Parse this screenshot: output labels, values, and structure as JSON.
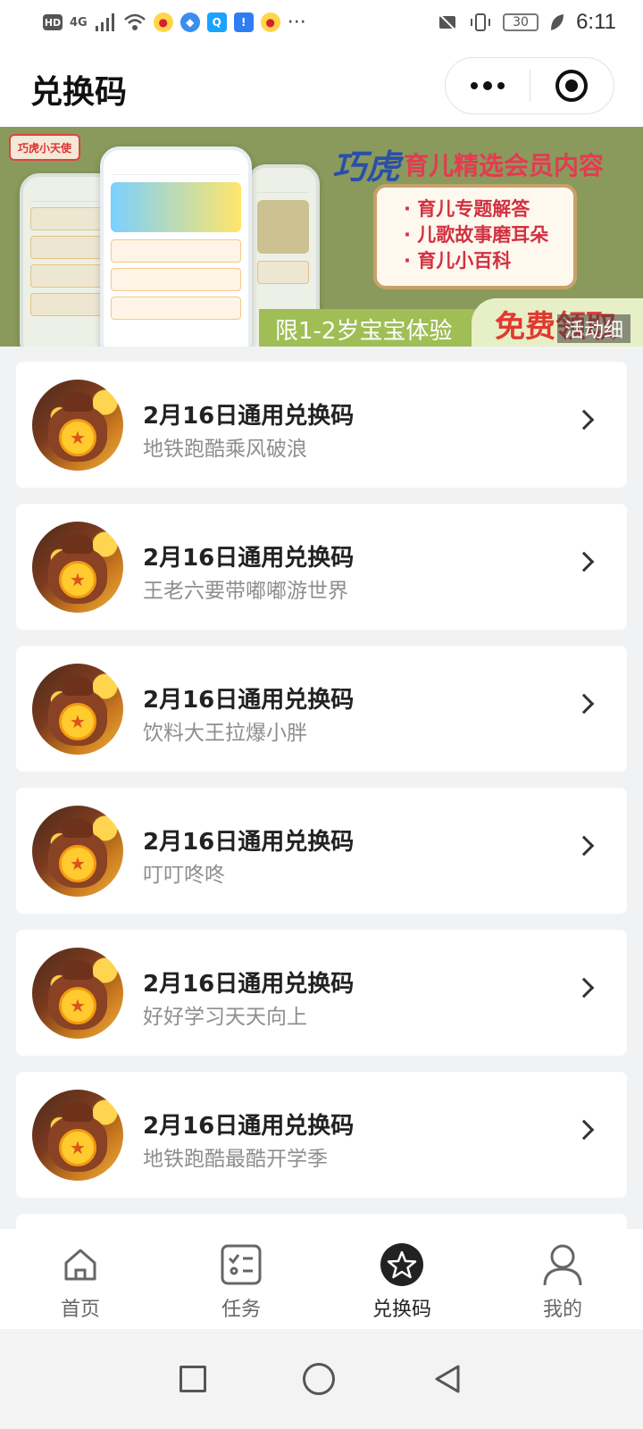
{
  "status_bar": {
    "hd_label": "HD",
    "network": "4G",
    "battery": "30",
    "time": "6:11",
    "more": "···"
  },
  "header": {
    "title": "兑换码"
  },
  "banner": {
    "logo_text": "巧虎小天使",
    "brand": "巧虎",
    "headline": "育儿精选会员内容",
    "bullets": [
      "· 育儿专题解答",
      "· 儿歌故事磨耳朵",
      "· 育儿小百科"
    ],
    "ribbon": "限1-2岁宝宝体验",
    "free_text": "免费领取",
    "rules_tag": "活动细"
  },
  "list": {
    "items": [
      {
        "title": "2月16日通用兑换码",
        "subtitle": "地铁跑酷乘风破浪"
      },
      {
        "title": "2月16日通用兑换码",
        "subtitle": "王老六要带嘟嘟游世界"
      },
      {
        "title": "2月16日通用兑换码",
        "subtitle": "饮料大王拉爆小胖"
      },
      {
        "title": "2月16日通用兑换码",
        "subtitle": "叮叮咚咚"
      },
      {
        "title": "2月16日通用兑换码",
        "subtitle": "好好学习天天向上"
      },
      {
        "title": "2月16日通用兑换码",
        "subtitle": "地铁跑酷最酷开学季"
      }
    ]
  },
  "tab_bar": {
    "items": [
      {
        "label": "首页",
        "icon": "home-icon"
      },
      {
        "label": "任务",
        "icon": "checklist-icon"
      },
      {
        "label": "兑换码",
        "icon": "star-icon",
        "active": true
      },
      {
        "label": "我的",
        "icon": "user-icon"
      }
    ]
  },
  "colors": {
    "banner_bg": "#8a9a5c",
    "brand_blue": "#2a4fa8",
    "headline_red": "#e43a52",
    "active_tab": "#222222"
  }
}
